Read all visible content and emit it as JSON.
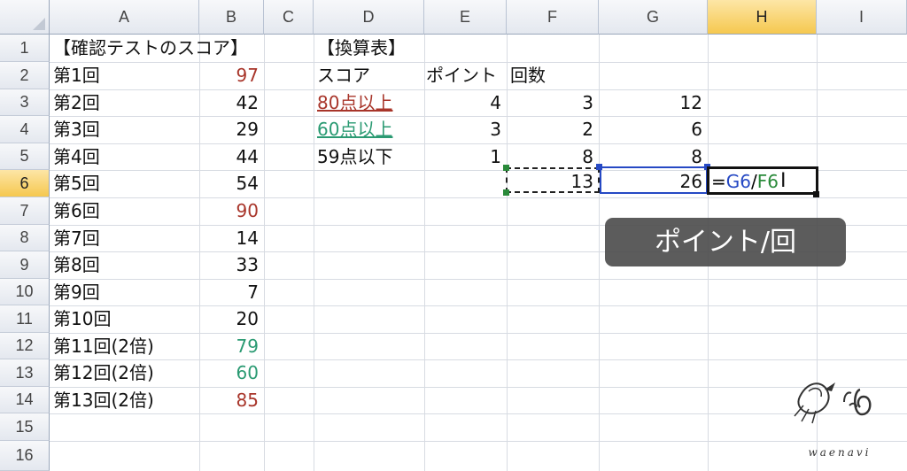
{
  "columns": [
    "A",
    "B",
    "C",
    "D",
    "E",
    "F",
    "G",
    "H",
    "I"
  ],
  "rows": [
    "1",
    "2",
    "3",
    "4",
    "5",
    "6",
    "7",
    "8",
    "9",
    "10",
    "11",
    "12",
    "13",
    "14",
    "15",
    "16"
  ],
  "active_cell": "H6",
  "colA": [
    "【確認テストのスコア】",
    "第1回",
    "第2回",
    "第3回",
    "第4回",
    "第5回",
    "第6回",
    "第7回",
    "第8回",
    "第9回",
    "第10回",
    "第11回(2倍)",
    "第12回(2倍)",
    "第13回(2倍)"
  ],
  "colB": [
    "",
    "97",
    "42",
    "29",
    "44",
    "54",
    "90",
    "14",
    "33",
    "7",
    "20",
    "79",
    "60",
    "85"
  ],
  "table": {
    "title": "【換算表】",
    "header_score": "スコア",
    "header_point": "ポイント",
    "header_count": "回数",
    "rows": [
      {
        "label": "80点以上",
        "point": "4",
        "count": "3",
        "product": "12"
      },
      {
        "label": "60点以上",
        "point": "3",
        "count": "2",
        "product": "6"
      },
      {
        "label": "59点以下",
        "point": "1",
        "count": "8",
        "product": "8"
      }
    ],
    "total_count": "13",
    "total_product": "26"
  },
  "formula": {
    "eq": "=",
    "ref1": "G6",
    "op": "/",
    "ref2": "F6"
  },
  "caption": "ポイント/回",
  "logo_text": "waenavi",
  "colors": {
    "red_values": "#a8352a",
    "green_values": "#2a9a72",
    "formula_ref1": "#2649c4",
    "formula_ref2": "#2a8a3a",
    "active_header": "#f5c84f"
  }
}
